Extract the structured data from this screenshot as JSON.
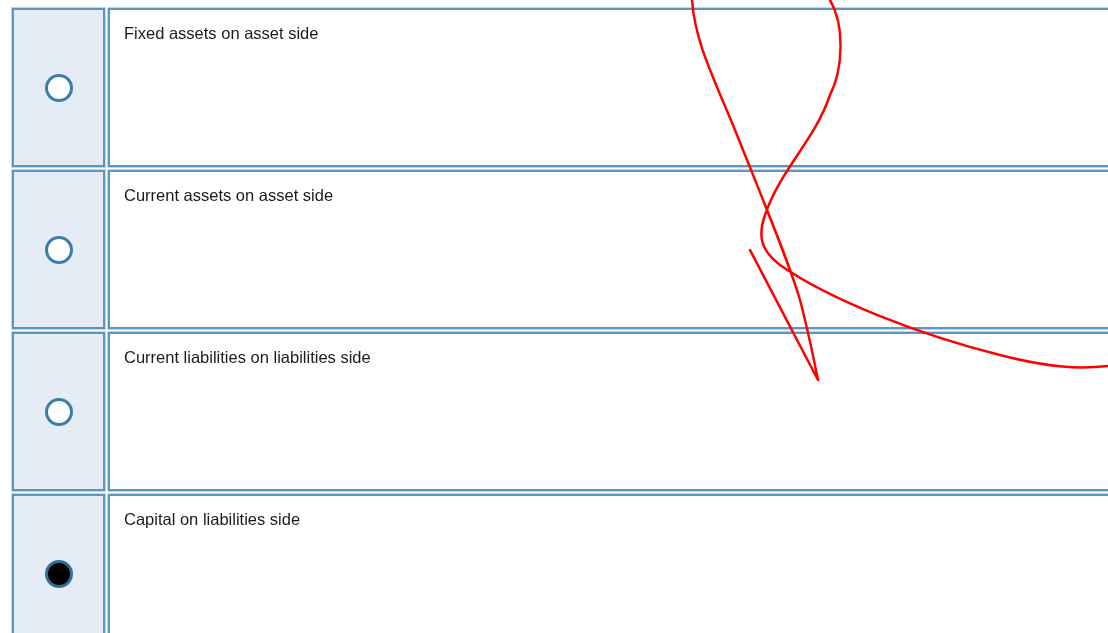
{
  "options": [
    {
      "label": "Fixed assets on asset side",
      "selected": false
    },
    {
      "label": "Current assets on asset side",
      "selected": false
    },
    {
      "label": "Current liabilities on liabilities side",
      "selected": false
    },
    {
      "label": "Capital on liabilities side",
      "selected": true
    }
  ]
}
